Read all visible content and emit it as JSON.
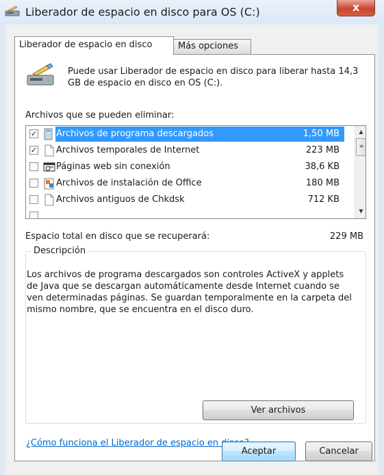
{
  "window": {
    "title": "Liberador de espacio en disco para OS (C:)",
    "close_glyph": "x",
    "icon": "disk-cleanup-icon"
  },
  "tabs": [
    {
      "label": "Liberador de espacio en disco",
      "active": true
    },
    {
      "label": "Más opciones",
      "active": false
    }
  ],
  "intro": {
    "text": "Puede usar Liberador de espacio en disco para liberar hasta 14,3 GB de espacio en disco en OS (C:).",
    "icon": "disk-cleanup-icon"
  },
  "files": {
    "label": "Archivos que se pueden eliminar:",
    "items": [
      {
        "name": "Archivos de programa descargados",
        "size": "1,50 MB",
        "checked": true,
        "selected": true,
        "icon": "folder-icon"
      },
      {
        "name": "Archivos temporales de Internet",
        "size": "223 MB",
        "checked": true,
        "selected": false,
        "icon": "document-icon"
      },
      {
        "name": "Páginas web sin conexión",
        "size": "38,6 KB",
        "checked": false,
        "selected": false,
        "icon": "offline-page-icon"
      },
      {
        "name": "Archivos de instalación de Office",
        "size": "180 MB",
        "checked": false,
        "selected": false,
        "icon": "office-setup-icon"
      },
      {
        "name": "Archivos antiguos de Chkdsk",
        "size": "712 KB",
        "checked": false,
        "selected": false,
        "icon": "document-icon"
      }
    ]
  },
  "total": {
    "label": "Espacio total en disco que se recuperará:",
    "value": "229 MB"
  },
  "description": {
    "legend": "Descripción",
    "text": "Los archivos de programa descargados son controles ActiveX y applets de Java que se descargan automáticamente desde Internet cuando se ven determinadas páginas. Se guardan temporalmente en la carpeta del mismo nombre, que se encuentra en el disco duro."
  },
  "buttons": {
    "view_files": "Ver archivos",
    "ok": "Aceptar",
    "cancel": "Cancelar"
  },
  "help_link": "¿Cómo funciona el Liberador de espacio en disco?",
  "colors": {
    "selection": "#3399ff",
    "link": "#0066cc",
    "close_button": "#c8442f"
  }
}
